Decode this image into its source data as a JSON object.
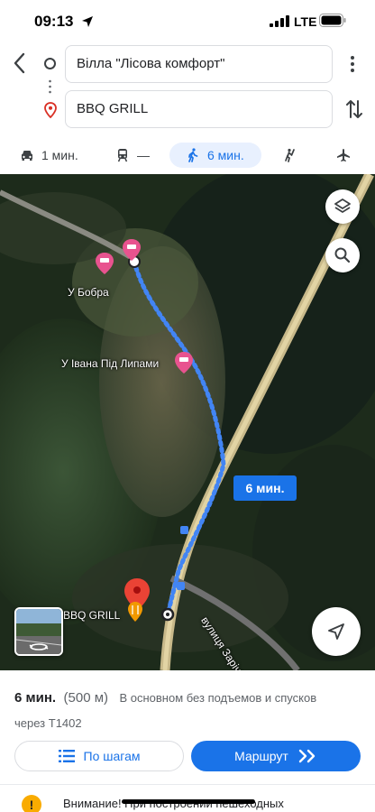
{
  "status_bar": {
    "time": "09:13",
    "network": "LTE"
  },
  "route_inputs": {
    "origin": "Вілла \"Лісова комфорт\"",
    "destination": "BBQ GRILL"
  },
  "modes": [
    {
      "name": "driving",
      "icon": "car-icon",
      "label": "1 мин."
    },
    {
      "name": "transit",
      "icon": "train-icon",
      "label": "—"
    },
    {
      "name": "walking",
      "icon": "walk-icon",
      "label": "6 мин.",
      "selected": true
    },
    {
      "name": "ride",
      "icon": "hail-icon",
      "label": ""
    },
    {
      "name": "flight",
      "icon": "airplane-icon",
      "label": ""
    }
  ],
  "map": {
    "places": [
      {
        "label": "У Бобра",
        "icon": "hotel-icon"
      },
      {
        "label": "У Івана Під Липами",
        "icon": "hotel-icon"
      },
      {
        "label": "BBQ GRILL",
        "icon": "restaurant-icon"
      }
    ],
    "eta_badge": "6 мин.",
    "street": "вулиця Зарічна",
    "route_color": "#4285f4"
  },
  "summary": {
    "duration": "6 мин.",
    "distance": "(500 м)",
    "description": "В основном без подъемов и спусков",
    "via": "через Т1402"
  },
  "actions": {
    "steps_label": "По шагам",
    "route_label": "Маршрут"
  },
  "warning": {
    "text": "Внимание! При построении пешеходных"
  },
  "colors": {
    "accent": "#1a73e8",
    "warning": "#f9ab00"
  }
}
